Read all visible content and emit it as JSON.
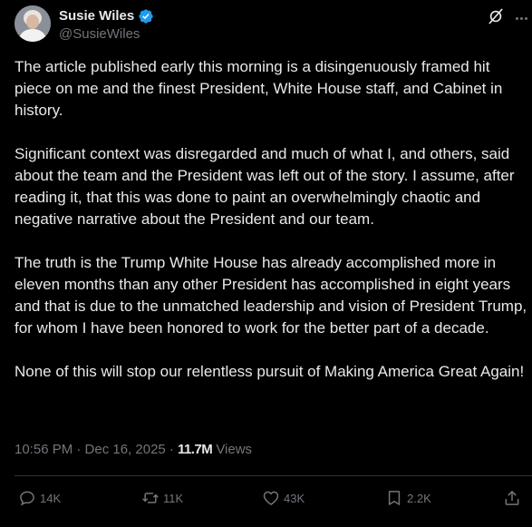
{
  "author": {
    "display_name": "Susie Wiles",
    "handle": "@SusieWiles",
    "verified": true,
    "verified_color": "#1d9bf0"
  },
  "tweet": {
    "paragraphs": [
      "The article published early this morning is a disingenuously framed hit piece on me and the finest President, White House staff, and Cabinet in history.",
      "Significant context was disregarded and much of what I, and others, said about the team and the President was left out of the story. I assume, after reading it, that this was done to paint an overwhelmingly chaotic and negative narrative about the President and our team.",
      "The truth is the Trump White House has already accomplished more in eleven months than any other President has accomplished in eight years and that is due to the unmatched leadership and vision of President Trump, for whom I have been honored to work for the better part of a decade.",
      "None of this will stop our relentless pursuit of Making America Great Again!"
    ]
  },
  "meta": {
    "timestamp": "10:56 PM · Dec 16, 2025 · ",
    "views_count": "11.7M",
    "views_label": "Views"
  },
  "actions": {
    "replies": "14K",
    "reposts": "11K",
    "likes": "43K",
    "bookmarks": "2.2K"
  },
  "icons": {
    "grok": "grok-icon",
    "more": "more-icon",
    "reply": "reply-icon",
    "repost": "repost-icon",
    "like": "heart-icon",
    "bookmark": "bookmark-icon",
    "share": "share-icon"
  },
  "colors": {
    "background": "#000000",
    "text_primary": "#e7e9ea",
    "text_secondary": "#71767b",
    "divider": "#2f3336"
  }
}
